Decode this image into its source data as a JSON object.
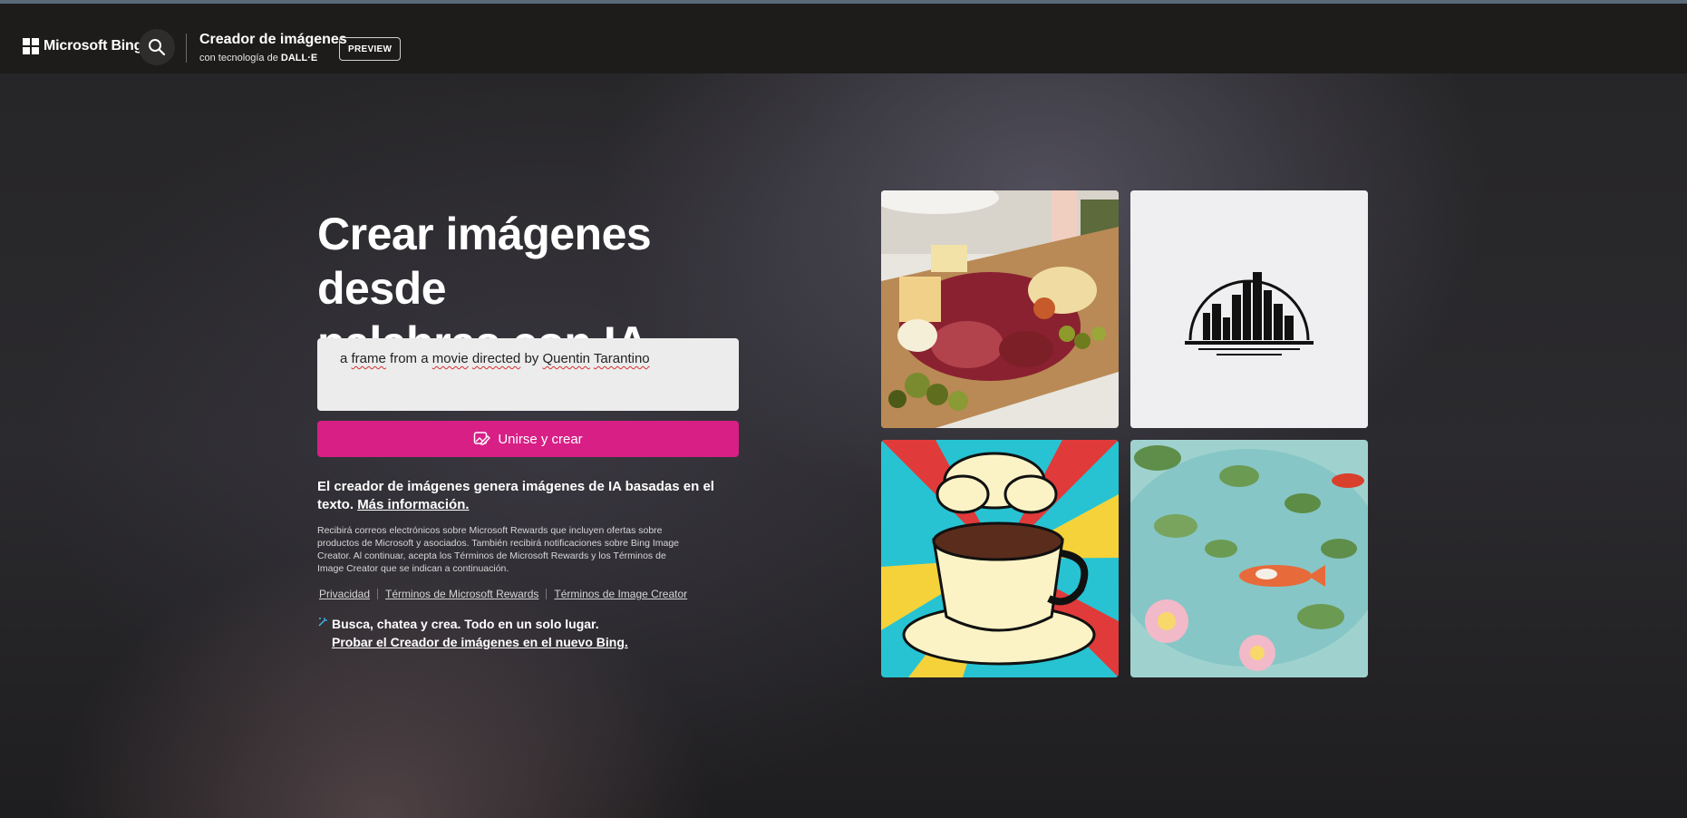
{
  "header": {
    "logo_label": "Microsoft Bing",
    "brand_title": "Creador de imágenes",
    "brand_sub_prefix": "con tecnología de",
    "brand_sub_engine": "DALL·E",
    "preview_label": "PREVIEW",
    "search_icon": "search-icon"
  },
  "hero": {
    "title_line1": "Crear imágenes desde",
    "title_line2": "palabras con IA"
  },
  "prompt": {
    "words": [
      "a",
      "frame",
      "from",
      "a",
      "movie",
      "directed",
      "by",
      "Quentin",
      "Tarantino"
    ]
  },
  "create_button": {
    "label": "Unirse y crear",
    "icon": "image-edit-icon"
  },
  "info": {
    "text": "El creador de imágenes genera imágenes de IA basadas en el texto.",
    "link": "Más información."
  },
  "legal": {
    "text": "Recibirá correos electrónicos sobre Microsoft Rewards que incluyen ofertas sobre productos de Microsoft y asociados. También recibirá notificaciones sobre Bing Image Creator. Al continuar, acepta los Términos de Microsoft Rewards y los Términos de Image Creator que se indican a continuación."
  },
  "links": [
    "Privacidad",
    "Términos de Microsoft Rewards",
    "Términos de Image Creator"
  ],
  "promo": {
    "line1": "Busca, chatea y crea. Todo en un solo lugar.",
    "line2": "Probar el Creador de imágenes en el nuevo Bing.",
    "icon": "sparkle-icon"
  },
  "gallery": [
    "charcuterie-board-image",
    "city-skyline-logo-image",
    "pop-art-coffee-cup-image",
    "koi-pond-watercolor-image"
  ],
  "colors": {
    "accent": "#d71f86",
    "header_bg": "#1d1c1b",
    "prompt_bg": "#ececec"
  }
}
